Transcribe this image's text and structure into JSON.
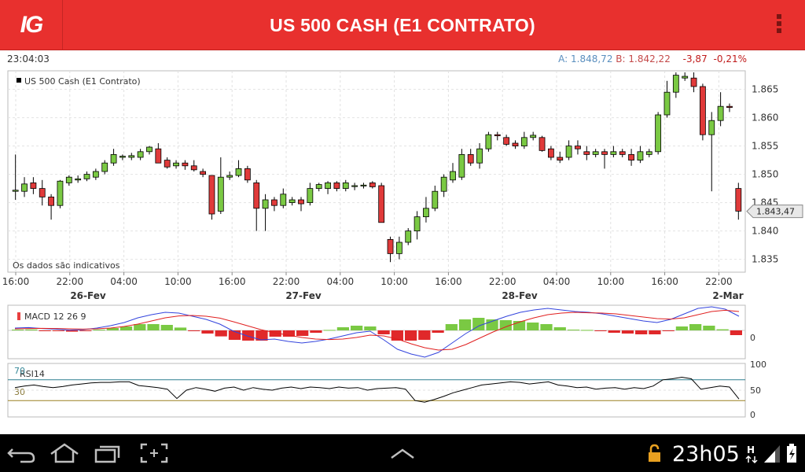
{
  "app": {
    "title": "US 500 CASH (E1 CONTRATO)",
    "logo": "IG",
    "brand_color": "#e8302e"
  },
  "quote": {
    "time": "23:04:03",
    "ask_label": "A:",
    "ask_value": "1.848,72",
    "bid_label": "B:",
    "bid_value": "1.842,22",
    "change": "-3,87",
    "change_pct": "-0,21%"
  },
  "chart_data": {
    "type": "candlestick",
    "legend": "US 500 Cash (E1 Contrato)",
    "note": "Os dados são indicativos",
    "last_price_label": "1.843,47",
    "last_price": 1843.47,
    "ylim": [
      1833,
      1868
    ],
    "y_ticks": [
      1835,
      1840,
      1845,
      1850,
      1855,
      1860,
      1865
    ],
    "y_tick_labels": [
      "1.835",
      "1.840",
      "1.845",
      "1.850",
      "1.855",
      "1.860",
      "1.865"
    ],
    "x_tick_labels": [
      "16:00",
      "22:00",
      "04:00",
      "10:00",
      "16:00",
      "22:00",
      "04:00",
      "10:00",
      "16:00",
      "22:00",
      "04:00",
      "10:00",
      "16:00",
      "22:00"
    ],
    "date_labels": [
      "26-Fev",
      "27-Fev",
      "28-Fev",
      "2-Mar"
    ],
    "candles": [
      {
        "o": 1847.0,
        "h": 1853.5,
        "l": 1845.5,
        "c": 1847.2
      },
      {
        "o": 1847.0,
        "h": 1849.5,
        "l": 1846.0,
        "c": 1848.3
      },
      {
        "o": 1848.5,
        "h": 1849.5,
        "l": 1846.5,
        "c": 1847.5
      },
      {
        "o": 1847.5,
        "h": 1849.0,
        "l": 1844.5,
        "c": 1846.0
      },
      {
        "o": 1846.0,
        "h": 1846.5,
        "l": 1842.0,
        "c": 1844.5
      },
      {
        "o": 1844.5,
        "h": 1849.0,
        "l": 1844.0,
        "c": 1848.8
      },
      {
        "o": 1848.5,
        "h": 1849.8,
        "l": 1848.0,
        "c": 1849.5
      },
      {
        "o": 1849.0,
        "h": 1849.8,
        "l": 1848.5,
        "c": 1849.2
      },
      {
        "o": 1849.2,
        "h": 1850.5,
        "l": 1848.8,
        "c": 1850.0
      },
      {
        "o": 1849.5,
        "h": 1851.0,
        "l": 1849.0,
        "c": 1850.5
      },
      {
        "o": 1850.5,
        "h": 1852.5,
        "l": 1850.0,
        "c": 1852.0
      },
      {
        "o": 1852.0,
        "h": 1854.5,
        "l": 1851.5,
        "c": 1853.5
      },
      {
        "o": 1853.0,
        "h": 1853.5,
        "l": 1852.5,
        "c": 1853.2
      },
      {
        "o": 1853.0,
        "h": 1853.8,
        "l": 1852.5,
        "c": 1853.3
      },
      {
        "o": 1853.0,
        "h": 1854.5,
        "l": 1852.5,
        "c": 1854.0
      },
      {
        "o": 1854.0,
        "h": 1855.0,
        "l": 1853.5,
        "c": 1854.8
      },
      {
        "o": 1854.5,
        "h": 1855.5,
        "l": 1852.0,
        "c": 1852.0
      },
      {
        "o": 1852.5,
        "h": 1853.0,
        "l": 1851.0,
        "c": 1851.3
      },
      {
        "o": 1851.5,
        "h": 1852.5,
        "l": 1851.0,
        "c": 1852.0
      },
      {
        "o": 1852.0,
        "h": 1852.5,
        "l": 1850.8,
        "c": 1851.5
      },
      {
        "o": 1851.5,
        "h": 1852.5,
        "l": 1850.5,
        "c": 1850.8
      },
      {
        "o": 1850.5,
        "h": 1851.0,
        "l": 1849.5,
        "c": 1850.0
      },
      {
        "o": 1849.8,
        "h": 1849.8,
        "l": 1842.0,
        "c": 1843.0
      },
      {
        "o": 1843.5,
        "h": 1853.0,
        "l": 1843.0,
        "c": 1849.5
      },
      {
        "o": 1849.5,
        "h": 1850.5,
        "l": 1849.0,
        "c": 1849.8
      },
      {
        "o": 1849.8,
        "h": 1852.5,
        "l": 1849.5,
        "c": 1851.0
      },
      {
        "o": 1851.0,
        "h": 1851.5,
        "l": 1848.5,
        "c": 1849.0
      },
      {
        "o": 1848.5,
        "h": 1849.0,
        "l": 1840.0,
        "c": 1844.0
      },
      {
        "o": 1844.0,
        "h": 1846.5,
        "l": 1840.0,
        "c": 1845.5
      },
      {
        "o": 1845.5,
        "h": 1846.0,
        "l": 1843.5,
        "c": 1844.5
      },
      {
        "o": 1844.5,
        "h": 1847.5,
        "l": 1844.0,
        "c": 1846.5
      },
      {
        "o": 1845.0,
        "h": 1846.0,
        "l": 1844.5,
        "c": 1845.5
      },
      {
        "o": 1845.5,
        "h": 1846.0,
        "l": 1843.5,
        "c": 1844.8
      },
      {
        "o": 1845.0,
        "h": 1848.5,
        "l": 1844.5,
        "c": 1847.5
      },
      {
        "o": 1847.5,
        "h": 1848.5,
        "l": 1847.0,
        "c": 1848.2
      },
      {
        "o": 1847.5,
        "h": 1848.8,
        "l": 1846.5,
        "c": 1848.5
      },
      {
        "o": 1848.5,
        "h": 1848.8,
        "l": 1847.0,
        "c": 1847.5
      },
      {
        "o": 1847.5,
        "h": 1849.0,
        "l": 1847.0,
        "c": 1848.5
      },
      {
        "o": 1848.0,
        "h": 1848.5,
        "l": 1847.2,
        "c": 1848.0
      },
      {
        "o": 1848.0,
        "h": 1848.5,
        "l": 1847.5,
        "c": 1848.1
      },
      {
        "o": 1848.5,
        "h": 1848.8,
        "l": 1847.5,
        "c": 1847.8
      },
      {
        "o": 1848.0,
        "h": 1848.5,
        "l": 1841.5,
        "c": 1841.5
      },
      {
        "o": 1838.5,
        "h": 1839.0,
        "l": 1834.5,
        "c": 1836.0
      },
      {
        "o": 1836.0,
        "h": 1839.0,
        "l": 1835.0,
        "c": 1838.0
      },
      {
        "o": 1838.0,
        "h": 1840.5,
        "l": 1837.5,
        "c": 1840.0
      },
      {
        "o": 1840.0,
        "h": 1843.5,
        "l": 1838.5,
        "c": 1842.5
      },
      {
        "o": 1842.5,
        "h": 1846.0,
        "l": 1841.5,
        "c": 1844.0
      },
      {
        "o": 1844.0,
        "h": 1848.0,
        "l": 1843.5,
        "c": 1847.0
      },
      {
        "o": 1847.0,
        "h": 1850.0,
        "l": 1846.0,
        "c": 1849.5
      },
      {
        "o": 1849.0,
        "h": 1852.0,
        "l": 1848.5,
        "c": 1850.5
      },
      {
        "o": 1849.5,
        "h": 1854.5,
        "l": 1849.0,
        "c": 1853.5
      },
      {
        "o": 1853.5,
        "h": 1854.5,
        "l": 1851.5,
        "c": 1852.0
      },
      {
        "o": 1852.0,
        "h": 1855.5,
        "l": 1851.0,
        "c": 1854.5
      },
      {
        "o": 1854.5,
        "h": 1857.5,
        "l": 1854.0,
        "c": 1857.0
      },
      {
        "o": 1857.0,
        "h": 1857.5,
        "l": 1856.0,
        "c": 1856.8
      },
      {
        "o": 1856.5,
        "h": 1857.0,
        "l": 1855.0,
        "c": 1855.3
      },
      {
        "o": 1855.5,
        "h": 1856.0,
        "l": 1854.5,
        "c": 1855.0
      },
      {
        "o": 1855.0,
        "h": 1857.5,
        "l": 1854.5,
        "c": 1856.5
      },
      {
        "o": 1856.5,
        "h": 1857.5,
        "l": 1856.0,
        "c": 1856.9
      },
      {
        "o": 1856.5,
        "h": 1856.8,
        "l": 1854.0,
        "c": 1854.2
      },
      {
        "o": 1854.5,
        "h": 1855.0,
        "l": 1852.5,
        "c": 1853.0
      },
      {
        "o": 1853.0,
        "h": 1854.0,
        "l": 1852.0,
        "c": 1852.5
      },
      {
        "o": 1853.0,
        "h": 1856.0,
        "l": 1852.5,
        "c": 1855.0
      },
      {
        "o": 1855.0,
        "h": 1856.0,
        "l": 1853.5,
        "c": 1854.5
      },
      {
        "o": 1854.0,
        "h": 1855.0,
        "l": 1852.5,
        "c": 1853.5
      },
      {
        "o": 1853.5,
        "h": 1854.5,
        "l": 1853.0,
        "c": 1854.0
      },
      {
        "o": 1854.0,
        "h": 1854.5,
        "l": 1851.0,
        "c": 1853.5
      },
      {
        "o": 1853.5,
        "h": 1855.0,
        "l": 1853.0,
        "c": 1854.0
      },
      {
        "o": 1854.0,
        "h": 1854.5,
        "l": 1853.0,
        "c": 1853.5
      },
      {
        "o": 1853.5,
        "h": 1854.5,
        "l": 1851.5,
        "c": 1852.5
      },
      {
        "o": 1852.5,
        "h": 1855.0,
        "l": 1852.0,
        "c": 1854.0
      },
      {
        "o": 1853.5,
        "h": 1854.5,
        "l": 1853.0,
        "c": 1854.0
      },
      {
        "o": 1854.0,
        "h": 1861.0,
        "l": 1853.5,
        "c": 1860.5
      },
      {
        "o": 1860.5,
        "h": 1866.5,
        "l": 1860.0,
        "c": 1864.5
      },
      {
        "o": 1864.5,
        "h": 1868.0,
        "l": 1863.5,
        "c": 1867.5
      },
      {
        "o": 1867.0,
        "h": 1868.0,
        "l": 1866.5,
        "c": 1867.3
      },
      {
        "o": 1867.0,
        "h": 1868.0,
        "l": 1864.5,
        "c": 1865.5
      },
      {
        "o": 1865.5,
        "h": 1866.0,
        "l": 1856.0,
        "c": 1857.0
      },
      {
        "o": 1857.0,
        "h": 1861.0,
        "l": 1847.0,
        "c": 1859.5
      },
      {
        "o": 1859.5,
        "h": 1864.5,
        "l": 1858.5,
        "c": 1862.0
      },
      {
        "o": 1862.0,
        "h": 1862.5,
        "l": 1861.0,
        "c": 1861.8
      },
      {
        "o": 1847.5,
        "h": 1848.5,
        "l": 1842.0,
        "c": 1843.5
      }
    ],
    "macd": {
      "label": "MACD 12 26 9",
      "zero_label": "0",
      "ylim": [
        -1.7,
        1.5
      ],
      "macd_line": [
        0.15,
        0.18,
        0.12,
        0.08,
        0.02,
        0.05,
        0.15,
        0.3,
        0.5,
        0.8,
        1.0,
        1.15,
        1.1,
        0.9,
        0.7,
        0.4,
        -0.05,
        -0.35,
        -0.6,
        -0.55,
        -0.7,
        -0.8,
        -0.7,
        -0.55,
        -0.35,
        -0.15,
        -0.05,
        -0.6,
        -1.2,
        -1.5,
        -1.7,
        -1.4,
        -0.8,
        -0.2,
        0.3,
        0.6,
        0.9,
        1.15,
        1.3,
        1.4,
        1.3,
        1.2,
        1.15,
        1.05,
        0.9,
        0.75,
        0.6,
        0.5,
        0.7,
        1.05,
        1.4,
        1.5,
        1.35,
        0.9
      ],
      "signal_line": [
        0.1,
        0.12,
        0.13,
        0.12,
        0.1,
        0.08,
        0.1,
        0.15,
        0.25,
        0.4,
        0.6,
        0.8,
        0.92,
        0.95,
        0.9,
        0.78,
        0.55,
        0.3,
        0.05,
        -0.15,
        -0.3,
        -0.45,
        -0.55,
        -0.58,
        -0.55,
        -0.45,
        -0.3,
        -0.35,
        -0.55,
        -0.85,
        -1.1,
        -1.25,
        -1.2,
        -0.9,
        -0.5,
        -0.1,
        0.25,
        0.55,
        0.8,
        1.0,
        1.1,
        1.15,
        1.12,
        1.1,
        1.05,
        0.95,
        0.85,
        0.75,
        0.72,
        0.8,
        1.0,
        1.2,
        1.28,
        1.2
      ],
      "histogram": [
        0.05,
        0.06,
        -0.01,
        -0.04,
        -0.08,
        -0.03,
        0.05,
        0.15,
        0.25,
        0.4,
        0.4,
        0.35,
        0.18,
        -0.05,
        -0.2,
        -0.38,
        -0.6,
        -0.65,
        -0.65,
        -0.4,
        -0.4,
        -0.35,
        -0.15,
        0.03,
        0.2,
        0.3,
        0.25,
        -0.25,
        -0.65,
        -0.65,
        -0.6,
        -0.15,
        0.4,
        0.7,
        0.8,
        0.7,
        0.65,
        0.6,
        0.5,
        0.4,
        0.2,
        0.05,
        0.03,
        -0.05,
        -0.15,
        -0.2,
        -0.25,
        -0.25,
        -0.02,
        0.25,
        0.4,
        0.3,
        0.07,
        -0.3
      ]
    },
    "rsi": {
      "label": "RSI14",
      "ylim": [
        0,
        100
      ],
      "y_tick_labels": [
        "100",
        "50",
        "0"
      ],
      "overbought_label": "70",
      "oversold_label": "30",
      "overbought": 70,
      "oversold": 30,
      "values": [
        55,
        58,
        60,
        57,
        55,
        57,
        60,
        62,
        64,
        65,
        65,
        66,
        66,
        59,
        57,
        55,
        52,
        34,
        50,
        55,
        52,
        48,
        54,
        56,
        50,
        55,
        52,
        50,
        54,
        56,
        53,
        56,
        55,
        53,
        56,
        54,
        55,
        50,
        53,
        54,
        55,
        52,
        30,
        27,
        32,
        38,
        45,
        50,
        55,
        60,
        62,
        64,
        66,
        65,
        62,
        64,
        66,
        60,
        58,
        55,
        56,
        52,
        54,
        55,
        52,
        55,
        53,
        58,
        70,
        72,
        75,
        72,
        52,
        55,
        58,
        56,
        33
      ]
    }
  },
  "nav": {
    "clock": "23h05",
    "icons": [
      "back-icon",
      "home-icon",
      "recent-apps-icon",
      "screenshot-icon",
      "up-arrow-icon",
      "lock-icon",
      "signal-icon",
      "battery-icon"
    ]
  }
}
